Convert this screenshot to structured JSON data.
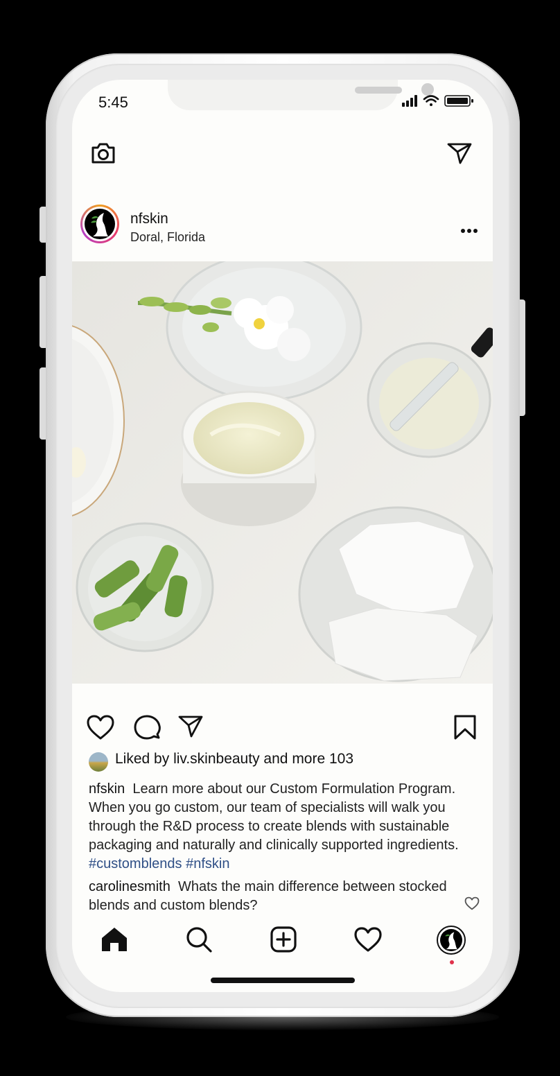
{
  "status_bar": {
    "time": "5:45"
  },
  "top_bar": {
    "camera_icon": "camera-icon",
    "direct_icon": "paper-plane-icon"
  },
  "post": {
    "username": "nfskin",
    "location": "Doral, Florida",
    "more_icon": "more-horizontal-icon",
    "image_subject": "skincare-ingredients-photo",
    "actions": [
      "heart-icon",
      "comment-icon",
      "share-icon",
      "bookmark-icon"
    ],
    "likes": {
      "prefix": "Liked by",
      "user": "liv.skinbeauty",
      "middle": "and",
      "suffix": "more 103"
    },
    "caption": {
      "username": "nfskin",
      "text": "Learn more about our Custom Formulation Program. When you go custom, our team of specialists will walk you through the R&D process to create blends with sustainable packaging and naturally and clinically supported ingredients.",
      "hashtags": "#customblends #nfskin"
    },
    "comment": {
      "username": "carolinesmith",
      "text": "Whats the main difference between stocked blends and custom blends?"
    }
  },
  "bottom_nav": [
    "home-icon",
    "search-icon",
    "add-post-icon",
    "activity-heart-icon",
    "profile-avatar"
  ],
  "colors": {
    "hashtag": "#2f4f86",
    "notification_dot": "#e0324b",
    "story_ring_start": "#f0a020",
    "story_ring_end": "#b63fc4"
  }
}
